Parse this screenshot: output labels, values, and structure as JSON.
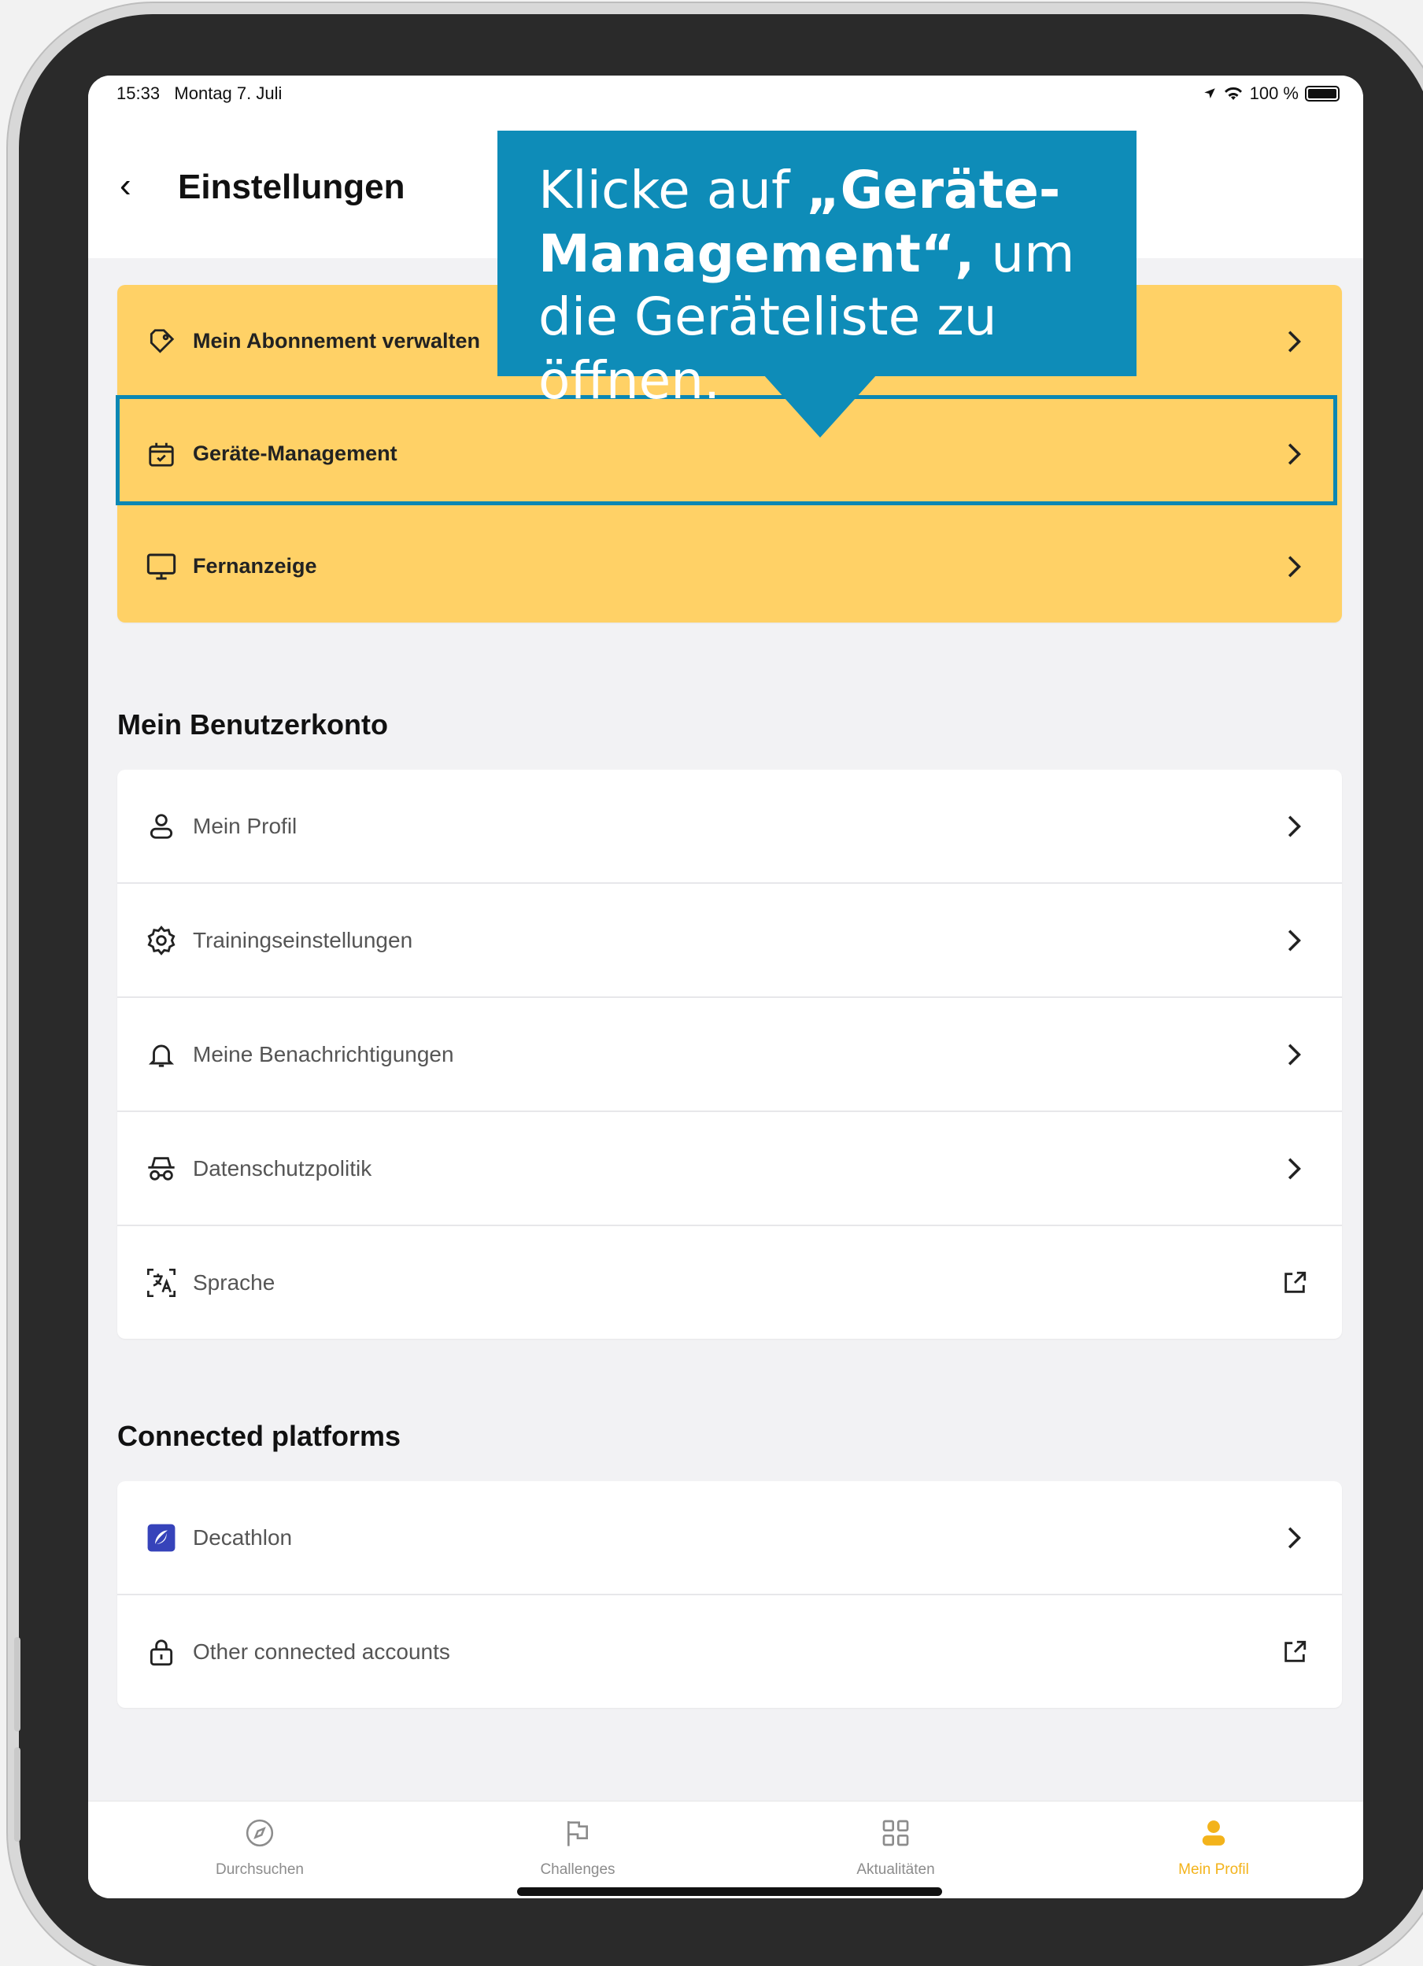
{
  "status": {
    "time": "15:33",
    "date": "Montag 7. Juli",
    "battery": "100 %"
  },
  "header": {
    "back_icon": "chevron-left-icon",
    "title": "Einstellungen"
  },
  "callout": {
    "prefix": "Klicke auf ",
    "bold": "„Geräte-Management“,",
    "suffix": " um die Geräteliste zu öffnen."
  },
  "premium_items": [
    {
      "label": "Mein Abonnement verwalten",
      "icon": "tag-icon"
    },
    {
      "label": "Geräte-Management",
      "icon": "device-box-icon"
    },
    {
      "label": "Fernanzeige",
      "icon": "monitor-icon"
    }
  ],
  "account": {
    "title": "Mein Benutzerkonto",
    "items": [
      {
        "label": "Mein Profil",
        "icon": "person-icon",
        "trail": "chevron-right-icon"
      },
      {
        "label": "Trainingseinstellungen",
        "icon": "gear-icon",
        "trail": "chevron-right-icon"
      },
      {
        "label": "Meine Benachrichtigungen",
        "icon": "bell-icon",
        "trail": "chevron-right-icon"
      },
      {
        "label": "Datenschutzpolitik",
        "icon": "incognito-icon",
        "trail": "chevron-right-icon"
      },
      {
        "label": "Sprache",
        "icon": "translate-icon",
        "trail": "external-link-icon"
      }
    ]
  },
  "platforms": {
    "title": "Connected platforms",
    "items": [
      {
        "label": "Decathlon",
        "icon": "decathlon-logo",
        "trail": "chevron-right-icon"
      },
      {
        "label": "Other connected accounts",
        "icon": "lock-icon",
        "trail": "external-link-icon"
      }
    ]
  },
  "tabs": [
    {
      "label": "Durchsuchen",
      "icon": "compass-icon"
    },
    {
      "label": "Challenges",
      "icon": "flag-icon"
    },
    {
      "label": "Aktualitäten",
      "icon": "grid-icon"
    },
    {
      "label": "Mein Profil",
      "icon": "profile-icon",
      "active": true
    }
  ],
  "colors": {
    "accent": "#f3b31b",
    "premium_bg": "#ffd166",
    "callout": "#0e8cb8",
    "highlight": "#0b87b3"
  }
}
